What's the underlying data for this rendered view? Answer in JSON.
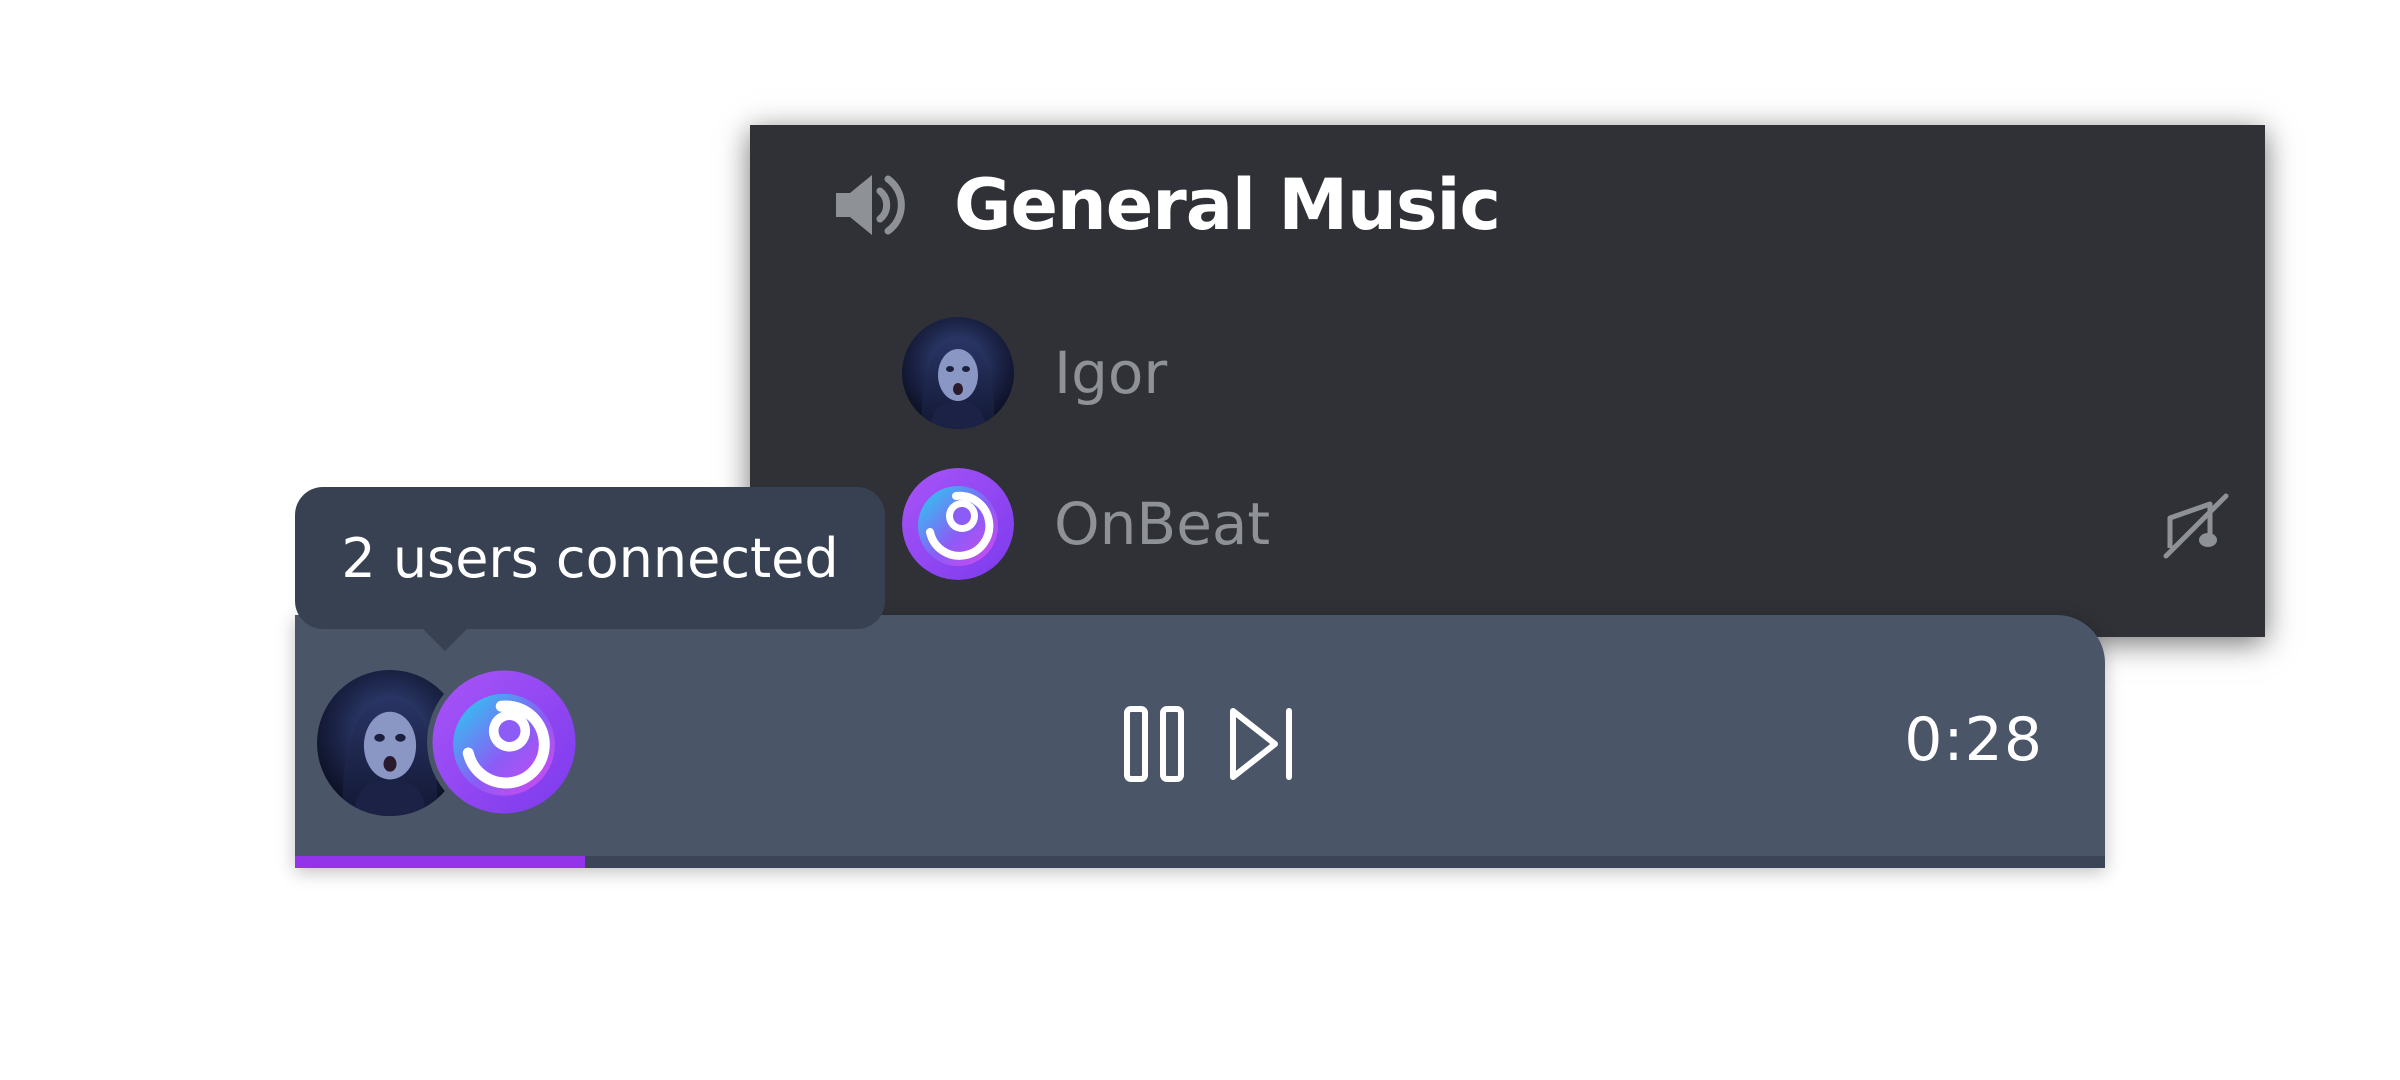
{
  "channel": {
    "title": "General Music",
    "icon": "speaker-icon",
    "members": [
      {
        "name": "Igor",
        "avatar": "user-photo-avatar"
      },
      {
        "name": "OnBeat",
        "avatar": "onbeat-logo-avatar",
        "status_icon": "music-muted-icon"
      }
    ]
  },
  "tooltip": {
    "text": "2 users connected"
  },
  "player": {
    "time": "0:28",
    "controls": [
      "pause-icon",
      "skip-next-icon"
    ],
    "progress": 0.16,
    "colors": {
      "background": "#4a5568",
      "progress": "#9333ea"
    }
  },
  "colors": {
    "panel": "#2f3136",
    "tooltip": "#374151",
    "muted_text": "#8e9297"
  }
}
